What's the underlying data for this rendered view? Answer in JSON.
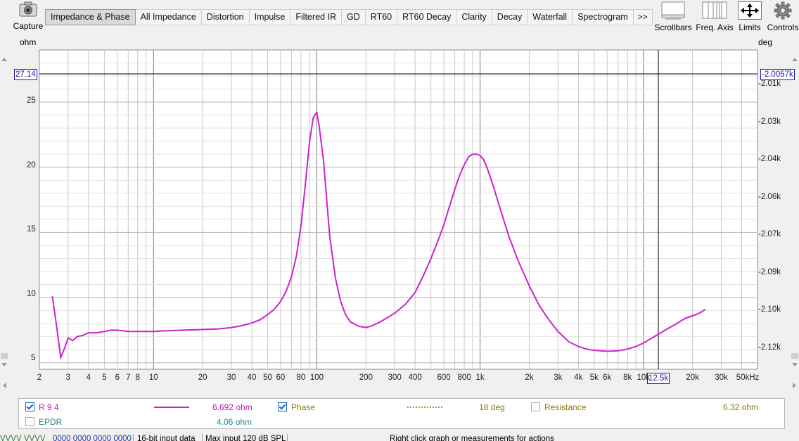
{
  "toolbar": {
    "capture_label": "Capture",
    "tabs": [
      "Impedance & Phase",
      "All Impedance",
      "Distortion",
      "Impulse",
      "Filtered IR",
      "GD",
      "RT60",
      "RT60 Decay",
      "Clarity",
      "Decay",
      "Waterfall",
      "Spectrogram"
    ],
    "more_label": ">>",
    "scrollbars_label": "Scrollbars",
    "freq_axis_label": "Freq. Axis",
    "limits_label": "Limits",
    "controls_label": "Controls"
  },
  "graph": {
    "left_unit": "ohm",
    "right_unit": "deg",
    "cursor_left": "27.14",
    "cursor_right": "-2.0057k",
    "cursor_x": "12.5k",
    "left_ticks": [
      "25",
      "20",
      "15",
      "10",
      "5"
    ],
    "right_ticks": [
      "-2.01k",
      "-2.03k",
      "-2.04k",
      "-2.06k",
      "-2.07k",
      "-2.09k",
      "-2.10k",
      "-2.12k"
    ],
    "x_ticks": [
      "2",
      "3",
      "4",
      "5",
      "6",
      "7",
      "8",
      "10",
      "20",
      "30",
      "40",
      "50",
      "60",
      "80",
      "100",
      "200",
      "300",
      "400",
      "600",
      "800",
      "1k",
      "2k",
      "3k",
      "4k",
      "5k",
      "6k",
      "8k",
      "10k",
      "20k",
      "30k",
      "50kHz"
    ]
  },
  "chart_data": {
    "type": "line",
    "title": "",
    "xlabel": "",
    "ylabel": "ohm",
    "y2label": "deg",
    "x_scale": "log",
    "xlim": [
      2,
      50000
    ],
    "ylim": [
      4.5,
      29
    ],
    "y2lim": [
      -2.13,
      -2.0
    ],
    "grid": true,
    "series": [
      {
        "name": "R 9 4",
        "color": "#cc22cc",
        "x": [
          2.4,
          2.55,
          2.7,
          2.85,
          3.0,
          3.2,
          3.4,
          3.7,
          4.0,
          4.5,
          5.0,
          5.5,
          6.0,
          7.0,
          8.0,
          10,
          12,
          15,
          20,
          25,
          30,
          35,
          40,
          45,
          50,
          55,
          60,
          65,
          70,
          75,
          80,
          85,
          90,
          95,
          100,
          103,
          110,
          115,
          120,
          130,
          140,
          150,
          160,
          180,
          200,
          220,
          250,
          300,
          350,
          400,
          450,
          500,
          550,
          600,
          650,
          700,
          750,
          800,
          850,
          900,
          950,
          1000,
          1050,
          1100,
          1150,
          1200,
          1300,
          1400,
          1500,
          1700,
          2000,
          2300,
          2600,
          3000,
          3500,
          4000,
          4500,
          5000,
          6000,
          7000,
          8000,
          9000,
          10000,
          12000,
          14000,
          16000,
          18000,
          20000,
          22000,
          24000
        ],
        "y": [
          10.1,
          7.8,
          5.4,
          6.1,
          6.9,
          6.7,
          7.0,
          7.1,
          7.3,
          7.3,
          7.4,
          7.5,
          7.5,
          7.4,
          7.4,
          7.4,
          7.45,
          7.5,
          7.55,
          7.6,
          7.7,
          7.85,
          8.05,
          8.3,
          8.7,
          9.1,
          9.7,
          10.5,
          11.6,
          13.2,
          15.5,
          18.6,
          21.8,
          23.8,
          24.2,
          23.3,
          20.5,
          17.5,
          14.7,
          11.5,
          9.7,
          8.7,
          8.15,
          7.8,
          7.7,
          7.85,
          8.2,
          8.8,
          9.5,
          10.4,
          11.7,
          13.0,
          14.3,
          15.6,
          17.0,
          18.3,
          19.4,
          20.2,
          20.8,
          21.0,
          21.0,
          20.9,
          20.6,
          20.0,
          19.3,
          18.6,
          17.2,
          15.9,
          14.7,
          12.9,
          10.9,
          9.4,
          8.4,
          7.4,
          6.6,
          6.25,
          6.05,
          5.95,
          5.88,
          5.92,
          6.05,
          6.25,
          6.5,
          7.1,
          7.6,
          8.0,
          8.4,
          8.6,
          8.8,
          9.1
        ]
      }
    ]
  },
  "legend": {
    "r_name": "R 9 4",
    "r_value": "6.692 ohm",
    "phase_name": "Phase",
    "phase_value": "18 deg",
    "resistance_name": "Resistance",
    "resistance_value": "6.32 ohm",
    "epdr_name": "EPDR",
    "epdr_value": "4.06 ohm"
  },
  "status": {
    "meter": "VVVV VVVV",
    "levels": "0000 0000 0000 0000",
    "bit_depth": "16-bit input data",
    "max_input": "Max input 120 dB SPL",
    "hint": "Right click graph or measurements for actions"
  }
}
